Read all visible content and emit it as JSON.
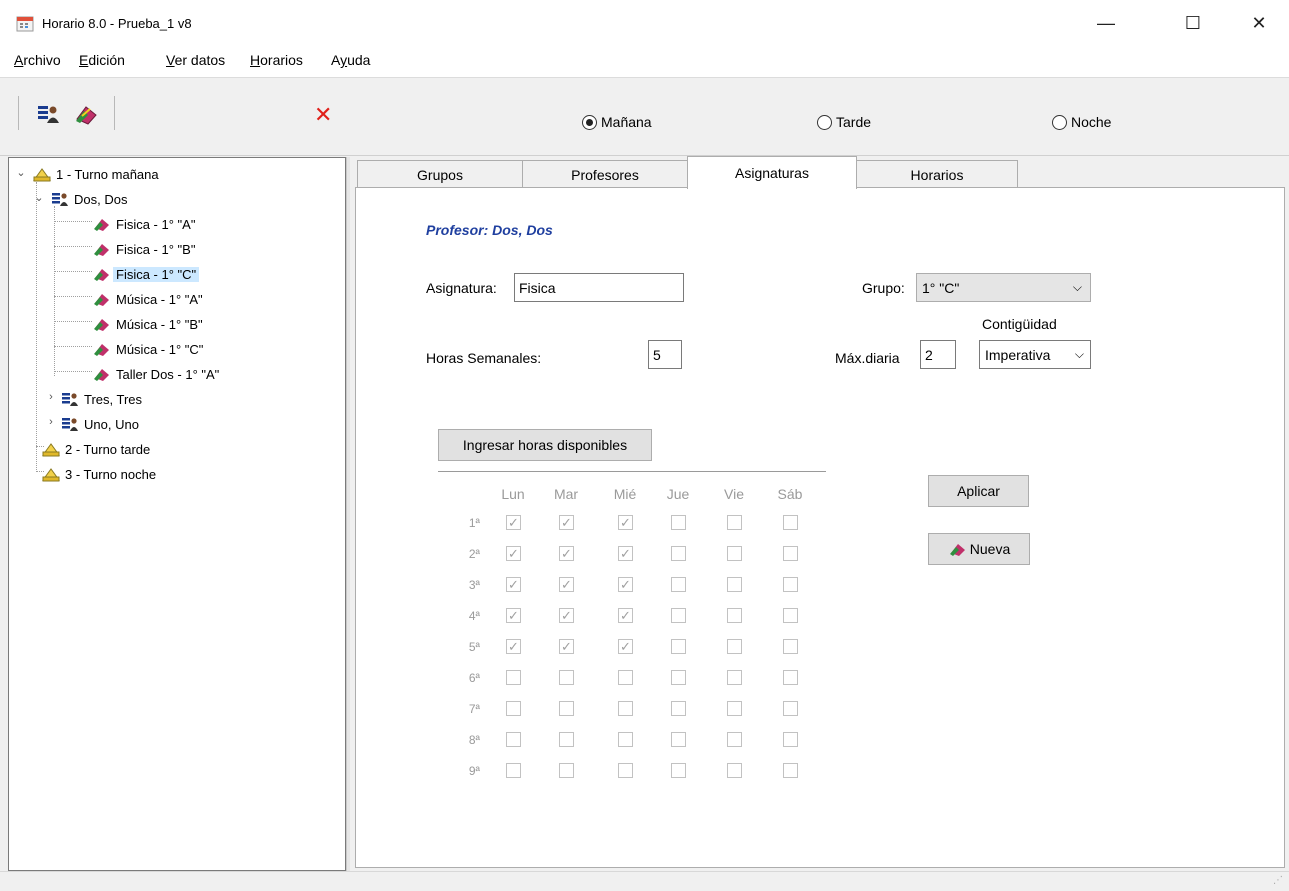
{
  "window": {
    "title": "Horario 8.0 - Prueba_1 v8",
    "minimize": "—",
    "maximize": "☐",
    "close": "✕"
  },
  "menu": [
    {
      "u": "A",
      "rest": "rchivo"
    },
    {
      "u": "E",
      "rest": "dición"
    },
    {
      "u": "V",
      "rest": "er datos"
    },
    {
      "u": "H",
      "rest": "orarios"
    },
    {
      "pre": "A",
      "u": "y",
      "rest": "uda"
    }
  ],
  "toolbar": {
    "delete_glyph": "✕",
    "turnos": [
      {
        "label": "Mañana",
        "selected": true
      },
      {
        "label": "Tarde",
        "selected": false
      },
      {
        "label": "Noche",
        "selected": false
      }
    ]
  },
  "tree": [
    {
      "label": "1 - Turno mañana",
      "icon": "turno-icon",
      "level": 0,
      "expanded": true
    },
    {
      "label": "Dos, Dos",
      "icon": "profesor-icon",
      "level": 1,
      "expanded": true
    },
    {
      "label": "Fisica - 1° \"A\"",
      "icon": "asignatura-icon",
      "level": 2
    },
    {
      "label": "Fisica - 1° \"B\"",
      "icon": "asignatura-icon",
      "level": 2
    },
    {
      "label": "Fisica - 1° \"C\"",
      "icon": "asignatura-icon",
      "level": 2,
      "selected": true
    },
    {
      "label": "Música - 1° \"A\"",
      "icon": "asignatura-icon",
      "level": 2
    },
    {
      "label": "Música - 1° \"B\"",
      "icon": "asignatura-icon",
      "level": 2
    },
    {
      "label": "Música - 1° \"C\"",
      "icon": "asignatura-icon",
      "level": 2
    },
    {
      "label": "Taller Dos - 1° \"A\"",
      "icon": "asignatura-icon",
      "level": 2
    },
    {
      "label": "Tres, Tres",
      "icon": "profesor-icon",
      "level": 1,
      "expanded": false
    },
    {
      "label": "Uno, Uno",
      "icon": "profesor-icon",
      "level": 1,
      "expanded": false
    },
    {
      "label": "2 - Turno tarde",
      "icon": "turno-icon",
      "level": 0
    },
    {
      "label": "3 - Turno noche",
      "icon": "turno-icon",
      "level": 0
    }
  ],
  "tabs": [
    "Grupos",
    "Profesores",
    "Asignaturas",
    "Horarios"
  ],
  "active_tab": "Asignaturas",
  "form": {
    "profesor_heading": "Profesor: Dos, Dos",
    "asignatura_label": "Asignatura:",
    "asignatura_value": "Fisica",
    "grupo_label": "Grupo:",
    "grupo_value": "1° \"C\"",
    "contiguidad_label": "Contigüidad",
    "horas_label": "Horas Semanales:",
    "horas_value": "5",
    "max_diaria_label": "Máx.diaria",
    "max_diaria_value": "2",
    "contiguidad_value": "Imperativa",
    "ingresar_button": "Ingresar horas disponibles",
    "aplicar_button": "Aplicar",
    "nueva_button": "Nueva"
  },
  "availability": {
    "days": [
      "Lun",
      "Mar",
      "Mié",
      "Jue",
      "Vie",
      "Sáb"
    ],
    "periods": [
      "1ª",
      "2ª",
      "3ª",
      "4ª",
      "5ª",
      "6ª",
      "7ª",
      "8ª",
      "9ª"
    ],
    "checked": [
      [
        true,
        true,
        true,
        false,
        false,
        false
      ],
      [
        true,
        true,
        true,
        false,
        false,
        false
      ],
      [
        true,
        true,
        true,
        false,
        false,
        false
      ],
      [
        true,
        true,
        true,
        false,
        false,
        false
      ],
      [
        true,
        true,
        true,
        false,
        false,
        false
      ],
      [
        false,
        false,
        false,
        false,
        false,
        false
      ],
      [
        false,
        false,
        false,
        false,
        false,
        false
      ],
      [
        false,
        false,
        false,
        false,
        false,
        false
      ],
      [
        false,
        false,
        false,
        false,
        false,
        false
      ]
    ]
  }
}
